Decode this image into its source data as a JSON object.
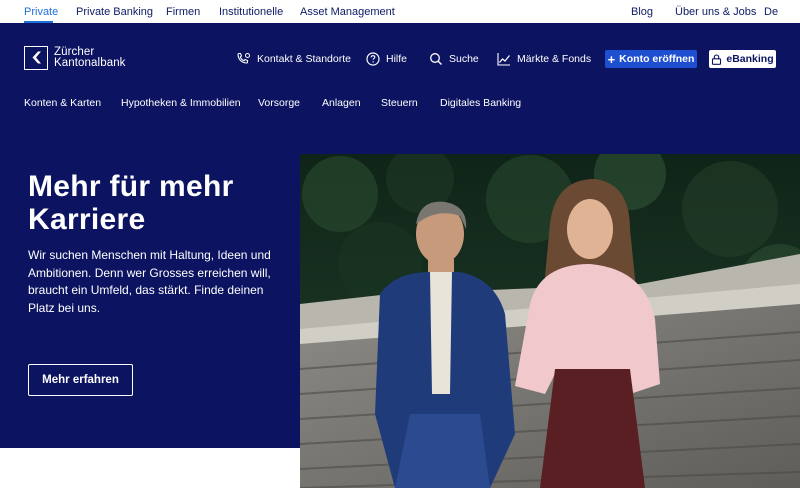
{
  "topbar": {
    "left_links": [
      "Private",
      "Private Banking",
      "Firmen",
      "Institutionelle",
      "Asset Management"
    ],
    "right_links": [
      "Blog",
      "Über uns & Jobs",
      "De"
    ],
    "active": "Private"
  },
  "logo": {
    "line1": "Zürcher",
    "line2": "Kantonalbank"
  },
  "header": {
    "contact": "Kontakt & Standorte",
    "help": "Hilfe",
    "search": "Suche",
    "markets": "Märkte & Fonds",
    "open_account": "Konto eröffnen",
    "ebanking": "eBanking"
  },
  "nav": [
    "Konten & Karten",
    "Hypotheken & Immobilien",
    "Vorsorge",
    "Anlagen",
    "Steuern",
    "Digitales Banking"
  ],
  "hero": {
    "title": "Mehr für mehr Karriere",
    "body": "Wir suchen Menschen mit Haltung, Ideen und Ambitionen. Denn wer Grosses erreichen will, braucht ein Umfeld, das stärkt. Finde deinen Platz bei uns.",
    "cta": "Mehr erfahren"
  },
  "colors": {
    "navy": "#0c1461",
    "accent_blue": "#1e4fd1",
    "link_active": "#1f6fd8"
  }
}
